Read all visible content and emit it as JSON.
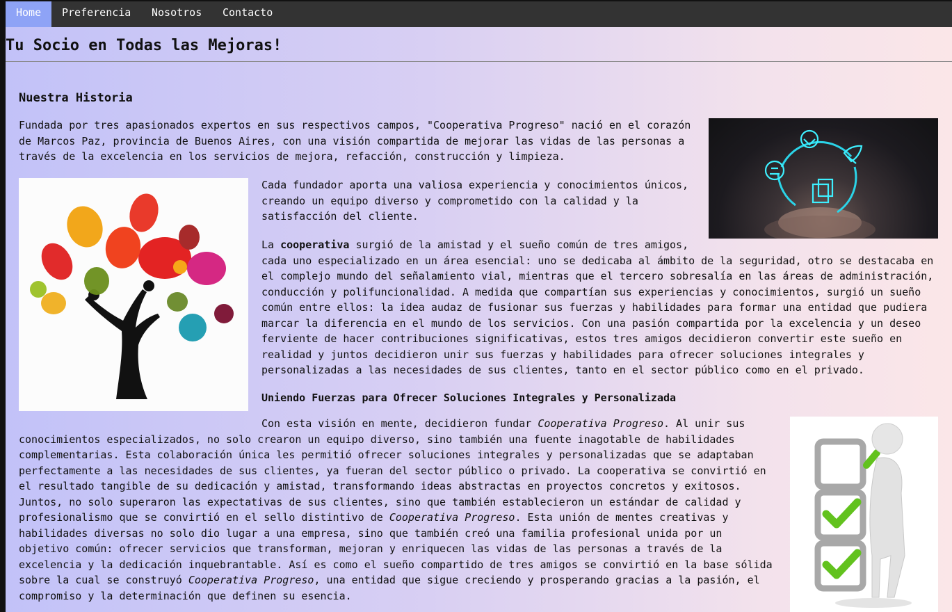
{
  "nav": {
    "items": [
      {
        "label": "Home",
        "active": true
      },
      {
        "label": "Preferencia",
        "active": false
      },
      {
        "label": "Nosotros",
        "active": false
      },
      {
        "label": "Contacto",
        "active": false
      }
    ]
  },
  "page_title": "Tu Socio en Todas las Mejoras!",
  "section": {
    "heading": "Nuestra Historia",
    "p1": [
      "Fundada por tres apasionados expertos en sus respectivos campos, \"Cooperativa Progreso\" nació en el corazón",
      "de Marcos Paz, provincia de Buenos Aires, con una visión compartida de mejorar las vidas de las personas a",
      "través de la excelencia en los servicios de mejora, refacción, construcción y limpieza."
    ],
    "p2": [
      "Cada fundador aporta una valiosa experiencia y conocimientos únicos,",
      "creando un equipo diverso y comprometido con la calidad y la",
      "satisfacción del cliente."
    ],
    "p3_prefix": "La ",
    "p3_bold": "cooperativa",
    "p3_first_rest": " surgió de la amistad y el sueño común de tres amigos,",
    "p3": [
      "cada uno especializado en un área esencial: uno se dedicaba al ámbito de la seguridad, otro se destacaba en",
      "el complejo mundo del señalamiento vial, mientras que el tercero sobresalía en las áreas de administración,",
      "conducción y polifuncionalidad. A medida que compartían sus experiencias y conocimientos, surgió un sueño",
      "común entre ellos: la idea audaz de fusionar sus fuerzas y habilidades para formar una entidad que pudiera",
      "marcar la diferencia en el mundo de los servicios. Con una pasión compartida por la excelencia y un deseo",
      "ferviente de hacer contribuciones significativas, estos tres amigos decidieron convertir este sueño en",
      "realidad y juntos decidieron unir sus fuerzas y habilidades para ofrecer soluciones integrales y",
      "personalizadas a las necesidades de sus clientes, tanto en el sector público como en el privado."
    ],
    "subheading": "Uniendo Fuerzas para Ofrecer Soluciones Integrales y Personalizada",
    "p4_first_prefix": "Con esta visión en mente, decidieron fundar ",
    "p4_italic": "Cooperativa Progreso",
    "p4_first_rest": ". Al unir sus",
    "p4": [
      "conocimientos especializados, no solo crearon un equipo diverso, sino también una fuente inagotable de habilidades",
      "complementarias. Esta colaboración única les permitió ofrecer soluciones integrales y personalizadas que se adaptaban",
      "perfectamente a las necesidades de sus clientes, ya fueran del sector público o privado. La cooperativa se convirtió en",
      "el resultado tangible de su dedicación y amistad, transformando ideas abstractas en proyectos concretos y exitosos.",
      "Juntos, no solo superaron las expectativas de sus clientes, sino que también establecieron un estándar de calidad y"
    ],
    "p4_l6_prefix": "profesionalismo que se convirtió en el sello distintivo de ",
    "p4_l6_rest": ". Esta unión de mentes creativas y",
    "p4_b": [
      "habilidades diversas no solo dio lugar a una empresa, sino que también creó una familia profesional unida por un",
      "objetivo común: ofrecer servicios que transforman, mejoran y enriquecen las vidas de las personas a través de la",
      "excelencia y la dedicación inquebrantable. Así es como el sueño compartido de tres amigos se convirtió en la base sólida"
    ],
    "p4_l10_prefix": "sobre la cual se construyó ",
    "p4_l10_rest": ", una entidad que sigue creciendo y prosperando gracias a la pasión, el",
    "p4_last": "compromiso y la determinación que definen su esencia."
  },
  "images": {
    "tree": "hands-tree-illustration",
    "hand": "hand-holding-glowing-icons",
    "checklist": "figure-with-checklist"
  },
  "colors": {
    "nav_bg": "#333333",
    "nav_active": "#8ea3f6",
    "bg_left": "#c2c2f8",
    "bg_right": "#fbe6e8"
  }
}
